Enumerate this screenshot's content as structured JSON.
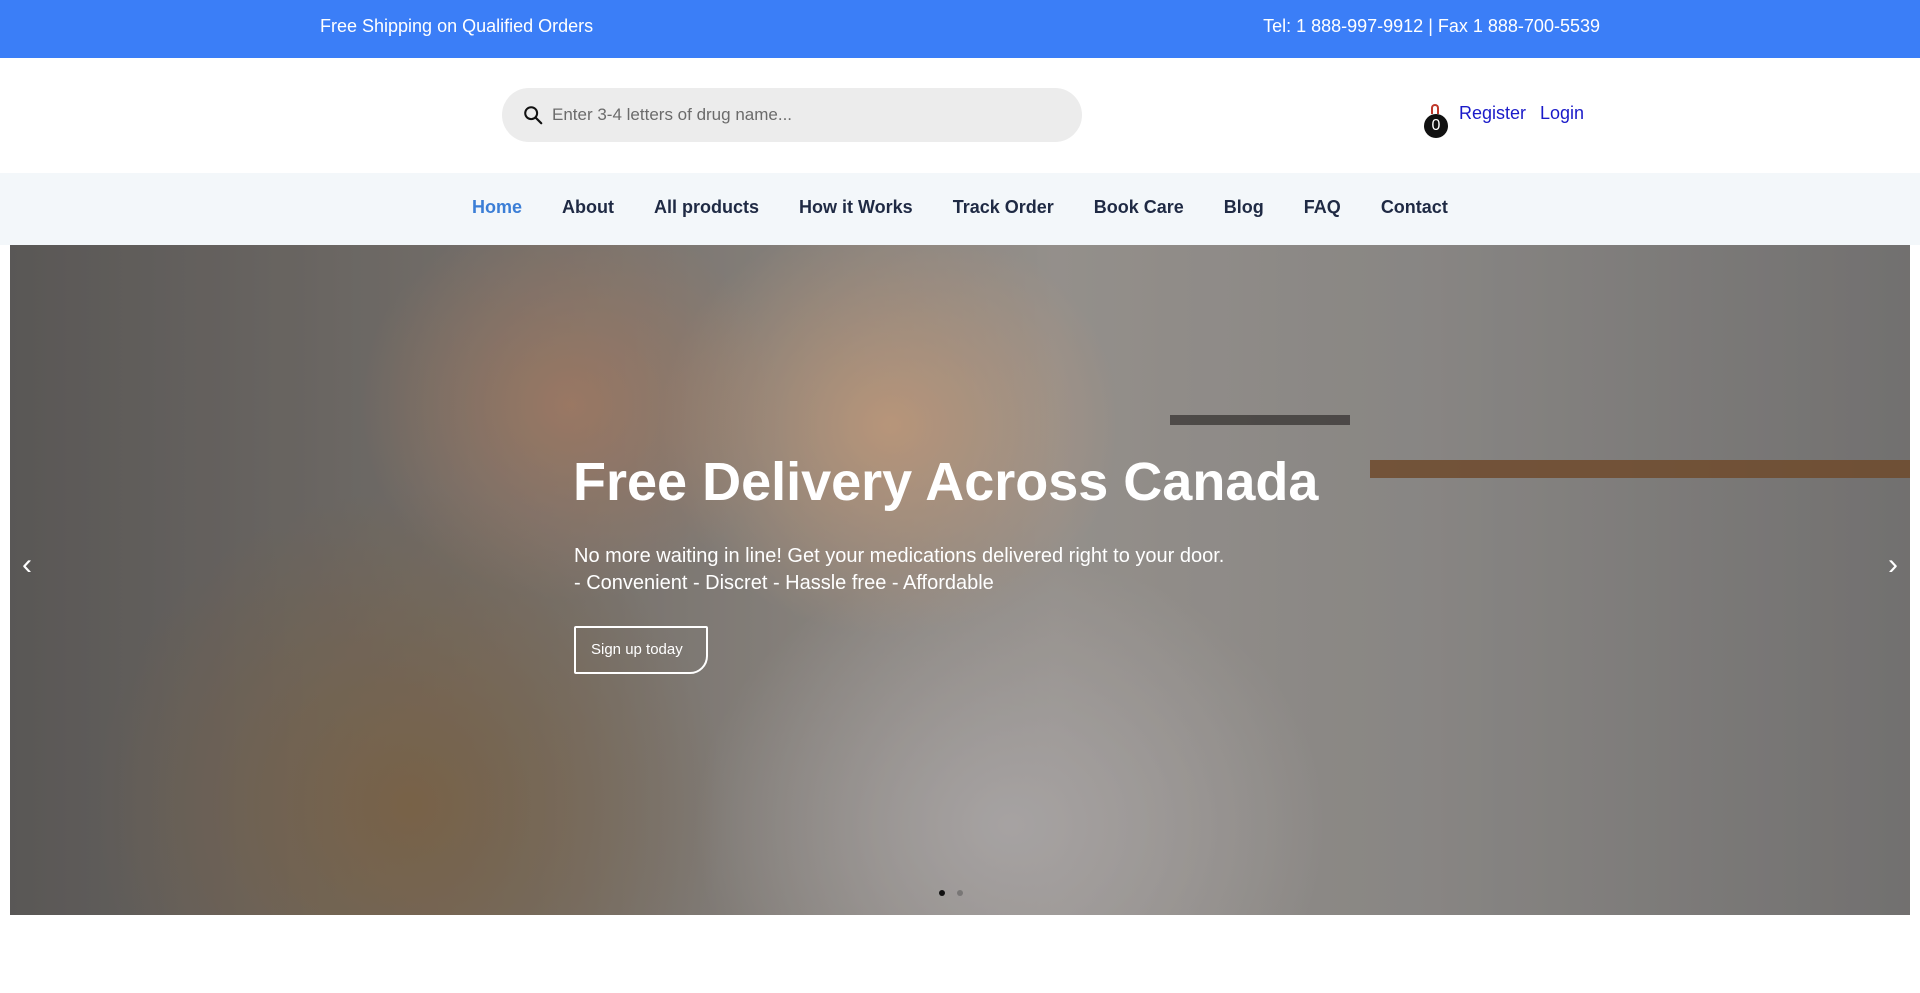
{
  "topbar": {
    "shipping_text": "Free Shipping on Qualified Orders",
    "contact_text": "Tel: 1 888-997-9912 | Fax 1 888-700-5539",
    "background": "#3b7ef7"
  },
  "header": {
    "search": {
      "placeholder": "Enter 3-4 letters of drug name...",
      "value": "",
      "icon": "search-icon"
    },
    "cart": {
      "icon": "shopping-bag-icon",
      "count": "0"
    },
    "register_label": "Register",
    "login_label": "Login"
  },
  "nav": {
    "items": [
      {
        "label": "Home",
        "active": true
      },
      {
        "label": "About"
      },
      {
        "label": "All products"
      },
      {
        "label": "How it Works"
      },
      {
        "label": "Track Order"
      },
      {
        "label": "Book Care"
      },
      {
        "label": "Blog"
      },
      {
        "label": "FAQ"
      },
      {
        "label": "Contact"
      }
    ],
    "active_color": "#3b7ed6"
  },
  "hero": {
    "title": "Free Delivery Across Canada",
    "line1": "No more waiting in line! Get your medications delivered right to your door.",
    "line2": "- Convenient - Discret - Hassle free - Affordable",
    "cta_label": "Sign up today",
    "prev_icon": "chevron-left-icon",
    "next_icon": "chevron-right-icon",
    "prev_glyph": "‹",
    "next_glyph": "›",
    "slide_count": 2,
    "active_slide": 1
  }
}
